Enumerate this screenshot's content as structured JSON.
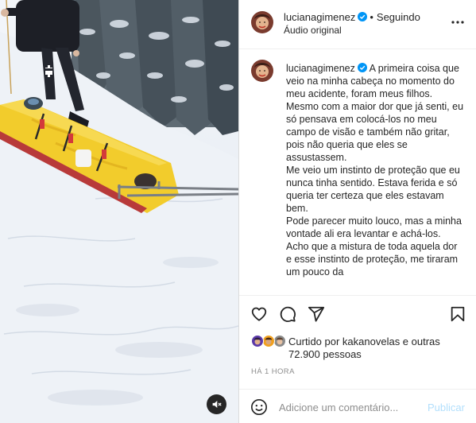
{
  "media": {
    "description_icon": "mute-icon"
  },
  "header": {
    "username": "lucianagimenez",
    "separator": "•",
    "follow_label": "Seguindo",
    "audio": "Áudio original",
    "more_icon": "more-options-icon"
  },
  "caption": {
    "username": "lucianagimenez",
    "paragraphs": [
      "A primeira coisa que veio na minha cabeça no momento do meu acidente, foram meus filhos.",
      "Mesmo com a maior dor que já senti, eu só pensava em colocá-los no meu campo de visão e também não gritar, pois não queria que eles se assustassem.",
      "Me veio um instinto de proteção que eu nunca tinha sentido. Estava ferida e só queria ter certeza que eles estavam bem.",
      "Pode parecer muito louco, mas a minha vontade ali era levantar e achá-los. Acho que a mistura de toda aquela dor e esse instinto de proteção, me tiraram um pouco da"
    ]
  },
  "actions": {
    "icons": [
      "heart-icon",
      "comment-icon",
      "share-icon",
      "bookmark-icon"
    ]
  },
  "likes": {
    "text": "Curtido por kakanovelas e outras 72.900 pessoas"
  },
  "timestamp": "HÁ 1 HORA",
  "comment": {
    "placeholder": "Adicione um comentário...",
    "publish_label": "Publicar"
  },
  "colors": {
    "verified_blue": "#0095f6",
    "publish_disabled": "#b2dffc",
    "muted_text": "#8e8e8e",
    "sled_yellow": "#f2cc2c"
  }
}
